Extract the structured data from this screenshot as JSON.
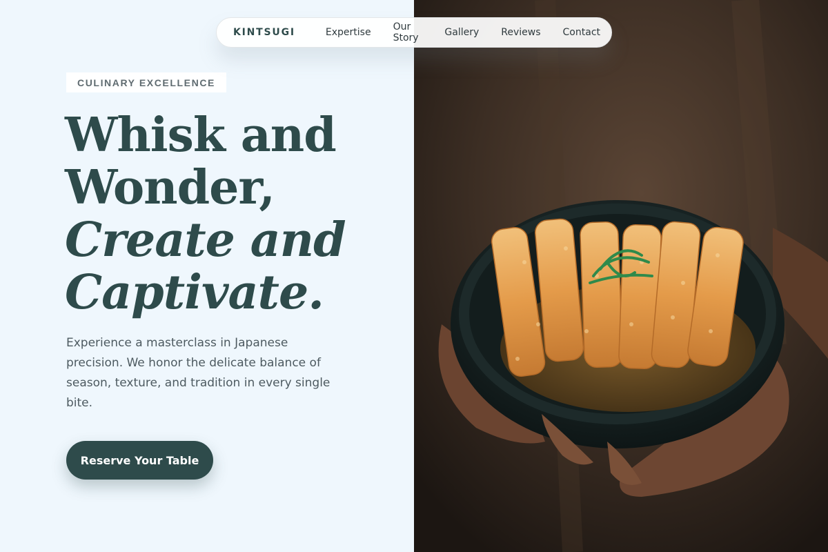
{
  "nav": {
    "brand": "KINTSUGI",
    "links": [
      "Expertise",
      "Our Story",
      "Gallery",
      "Reviews",
      "Contact"
    ]
  },
  "hero": {
    "eyebrow": "CULINARY EXCELLENCE",
    "headline": [
      "Whisk and",
      "Wonder,",
      "Create and",
      "Captivate."
    ],
    "lede": "Experience a masterclass in Japanese precision. We honor the delicate balance of season, texture, and tradition in every single bite.",
    "cta_label": "Reserve Your Table"
  },
  "colors": {
    "primary": "#2e4b4b",
    "background": "#eff7fd",
    "text_muted": "#4d5a60"
  }
}
